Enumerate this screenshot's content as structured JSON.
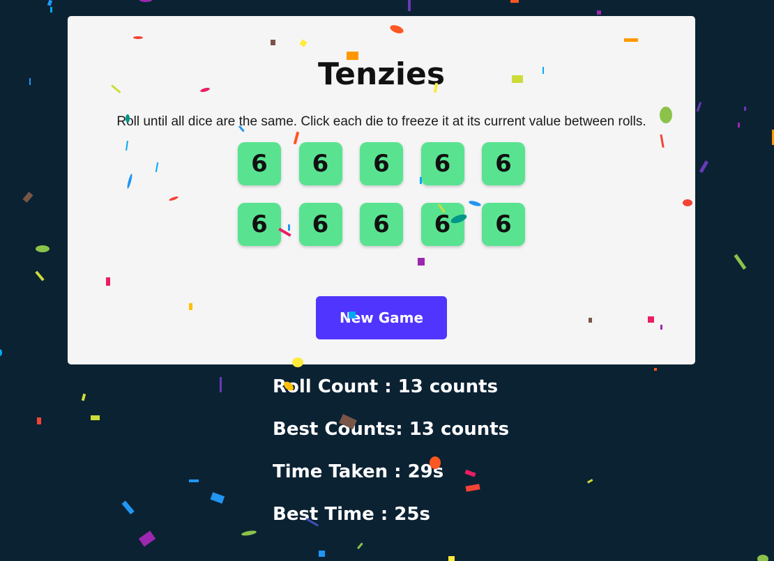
{
  "game": {
    "title": "Tenzies",
    "instructions": "Roll until all dice are the same. Click each die to freeze it at its current value between rolls.",
    "dice": [
      6,
      6,
      6,
      6,
      6,
      6,
      6,
      6,
      6,
      6
    ],
    "new_game_label": "New Game"
  },
  "stats": {
    "roll_count": "Roll Count : 13 counts",
    "best_counts": "Best Counts: 13 counts",
    "time_taken": "Time Taken : 29s",
    "best_time": "Best Time : 25s"
  },
  "colors": {
    "background": "#0b2233",
    "card": "#f5f5f5",
    "die": "#59e391",
    "button": "#5035ff"
  }
}
